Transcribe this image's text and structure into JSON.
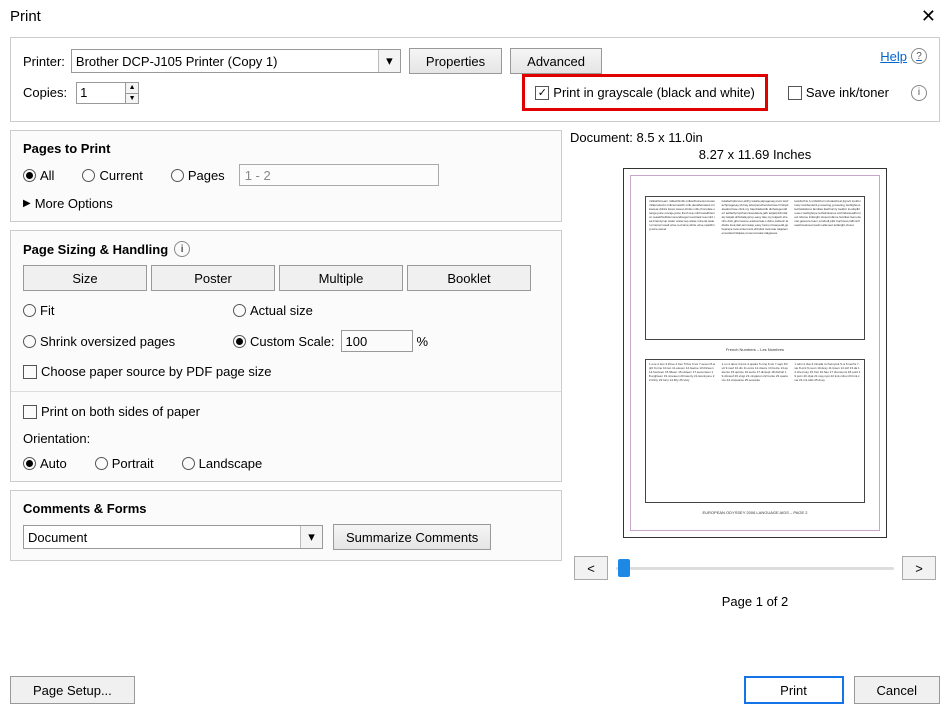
{
  "window": {
    "title": "Print"
  },
  "top": {
    "printer_label": "Printer:",
    "printer_value": "Brother DCP-J105 Printer (Copy 1)",
    "properties": "Properties",
    "advanced": "Advanced",
    "help": "Help",
    "copies_label": "Copies:",
    "copies_value": "1",
    "grayscale_label": "Print in grayscale (black and white)",
    "save_ink_label": "Save ink/toner"
  },
  "pages_print": {
    "title": "Pages to Print",
    "all": "All",
    "current": "Current",
    "pages": "Pages",
    "range_placeholder": "1 - 2",
    "more": "More Options"
  },
  "sizing": {
    "title": "Page Sizing & Handling",
    "size": "Size",
    "poster": "Poster",
    "multiple": "Multiple",
    "booklet": "Booklet",
    "fit": "Fit",
    "actual": "Actual size",
    "shrink": "Shrink oversized pages",
    "custom": "Custom Scale:",
    "scale_value": "100",
    "percent": "%",
    "choose_source": "Choose paper source by PDF page size",
    "both_sides": "Print on both sides of paper",
    "orientation_label": "Orientation:",
    "auto": "Auto",
    "portrait": "Portrait",
    "landscape": "Landscape"
  },
  "comments": {
    "title": "Comments & Forms",
    "doc_value": "Document",
    "summarize": "Summarize Comments"
  },
  "preview": {
    "doc_dims": "Document: 8.5 x 11.0in",
    "paper_dims": "8.27 x 11.69 Inches",
    "prev": "<",
    "next": ">",
    "page_counter": "Page 1 of 2"
  },
  "bottom": {
    "page_setup": "Page Setup...",
    "print": "Print",
    "cancel": "Cancel"
  }
}
